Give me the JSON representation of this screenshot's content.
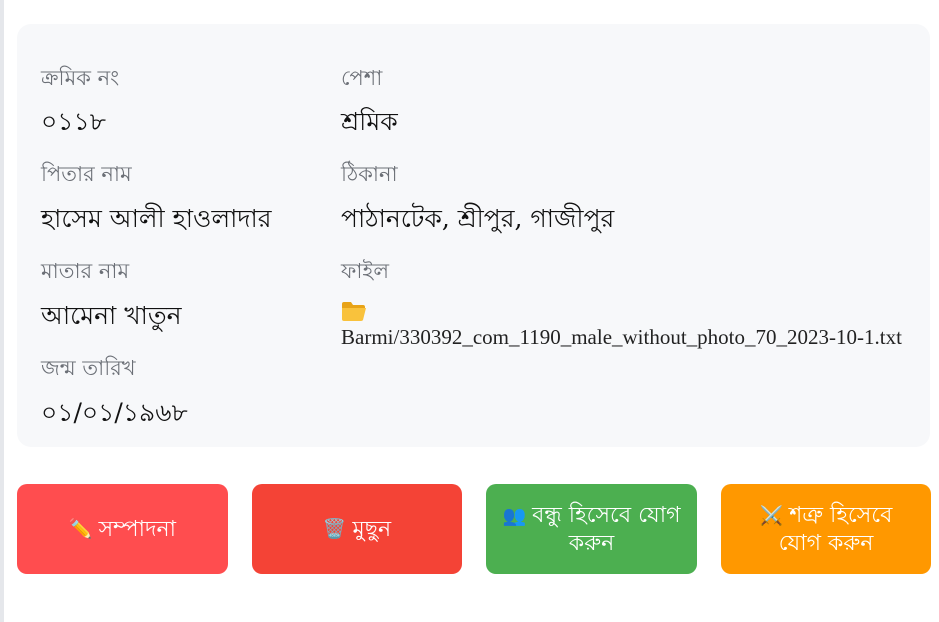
{
  "profile": {
    "serial_label": "ক্রমিক নং",
    "serial_value": "০১১৮",
    "father_label": "পিতার নাম",
    "father_value": "হাসেম আলী হাওলাদার",
    "mother_label": "মাতার নাম",
    "mother_value": "আমেনা খাতুন",
    "dob_label": "জন্ম তারিখ",
    "dob_value": "০১/০১/১৯৬৮",
    "occupation_label": "পেশা",
    "occupation_value": "শ্রমিক",
    "address_label": "ঠিকানা",
    "address_value": "পাঠানটেক, শ্রীপুর, গাজীপুর",
    "file_label": "ফাইল",
    "file_icon": "folder-icon",
    "file_path": "Barmi/330392_com_1190_male_without_photo_70_2023-10-1.txt"
  },
  "actions": {
    "edit_icon": "✏️",
    "edit_label": "সম্পাদনা",
    "delete_icon": "🗑️",
    "delete_label": "মুছুন",
    "friend_icon": "👥",
    "friend_label": "বন্ধু হিসেবে যোগ করুন",
    "enemy_icon": "⚔️",
    "enemy_label": "শত্রু হিসেবে যোগ করুন",
    "colors": {
      "edit": "#ff4d4f",
      "delete": "#f44336",
      "friend": "#4caf50",
      "enemy": "#ff9800"
    }
  }
}
